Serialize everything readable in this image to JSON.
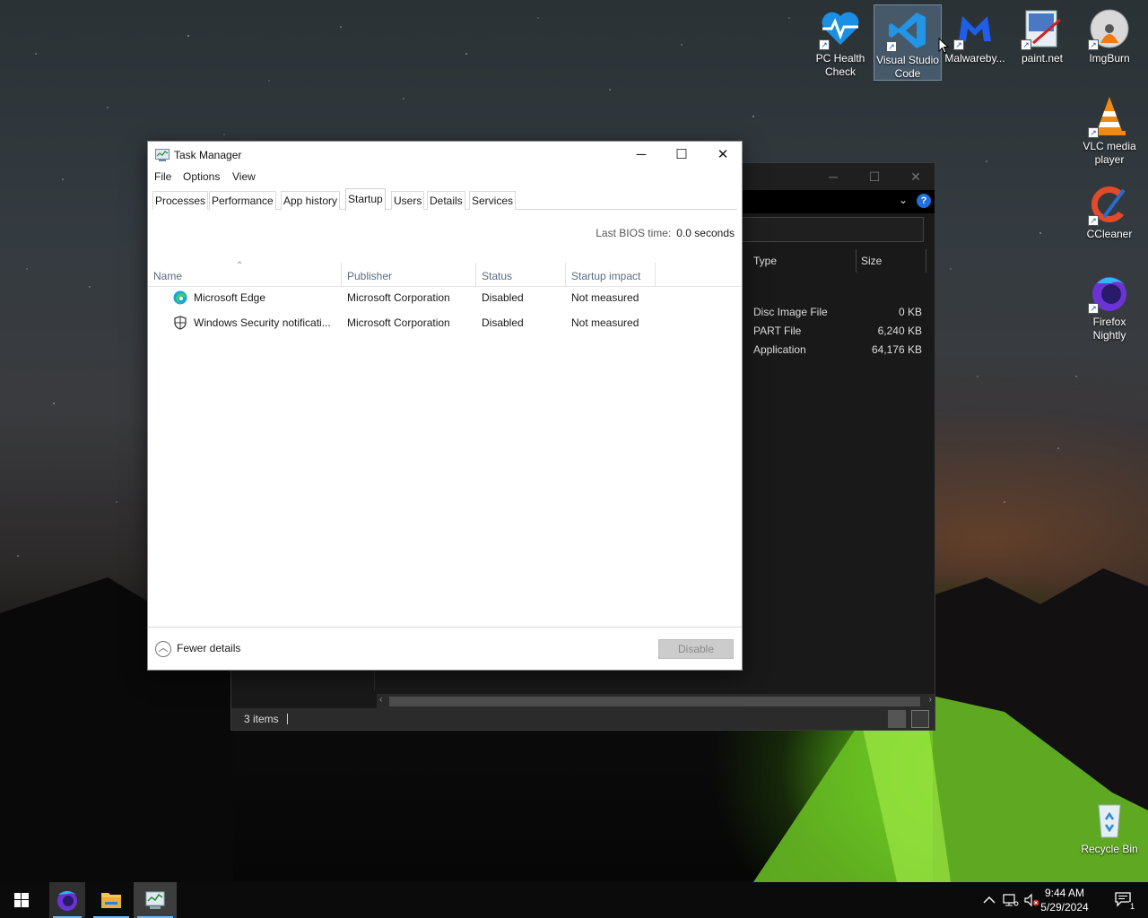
{
  "desktop": {
    "icons": [
      {
        "label_line1": "PC Health",
        "label_line2": "Check"
      },
      {
        "label_line1": "Visual Studio",
        "label_line2": "Code"
      },
      {
        "label_line1": "Malwareby...",
        "label_line2": ""
      },
      {
        "label_line1": "paint.net",
        "label_line2": ""
      },
      {
        "label_line1": "ImgBurn",
        "label_line2": ""
      },
      {
        "label_line1": "VLC media",
        "label_line2": "player"
      },
      {
        "label_line1": "CCleaner",
        "label_line2": ""
      },
      {
        "label_line1": "Firefox",
        "label_line2": "Nightly"
      },
      {
        "label_line1": "Recycle Bin",
        "label_line2": ""
      }
    ]
  },
  "explorer": {
    "columns": {
      "type": "Type",
      "size": "Size"
    },
    "rows": [
      {
        "type": "Disc Image File",
        "size": "0 KB"
      },
      {
        "type": "PART File",
        "size": "6,240 KB"
      },
      {
        "type": "Application",
        "size": "64,176 KB"
      }
    ],
    "status": {
      "items": "3 items"
    },
    "help_glyph": "?"
  },
  "task_manager": {
    "title": "Task Manager",
    "menu": {
      "file": "File",
      "options": "Options",
      "view": "View"
    },
    "tabs": [
      "Processes",
      "Performance",
      "App history",
      "Startup",
      "Users",
      "Details",
      "Services"
    ],
    "active_tab": "Startup",
    "bios": {
      "label": "Last BIOS time:",
      "value": "0.0 seconds"
    },
    "columns": {
      "name": "Name",
      "publisher": "Publisher",
      "status": "Status",
      "impact": "Startup impact"
    },
    "rows": [
      {
        "name": "Microsoft Edge",
        "publisher": "Microsoft Corporation",
        "status": "Disabled",
        "impact": "Not measured",
        "icon": "edge-icon"
      },
      {
        "name": "Windows Security notificati...",
        "publisher": "Microsoft Corporation",
        "status": "Disabled",
        "impact": "Not measured",
        "icon": "shield-icon"
      }
    ],
    "footer": {
      "fewer_details": "Fewer details",
      "disable": "Disable"
    }
  },
  "taskbar": {
    "clock": {
      "time": "9:44 AM",
      "date": "5/29/2024"
    },
    "notification_count": "1"
  },
  "colors": {
    "accent": "#1e6fe0",
    "taskbar": "#0b0b0b",
    "tent_glow": "#7ddb2a"
  }
}
